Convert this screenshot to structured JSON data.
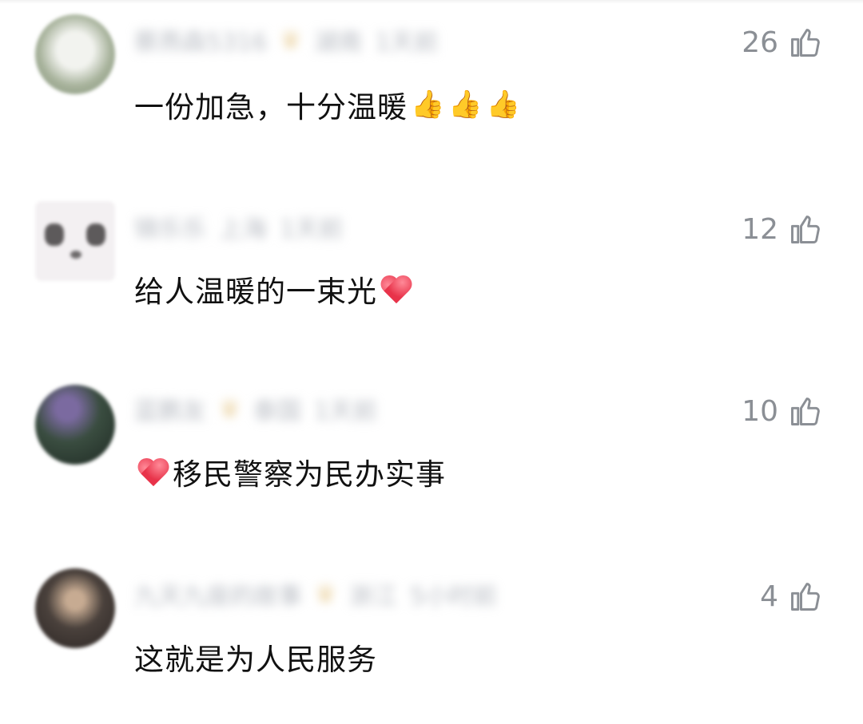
{
  "comments": [
    {
      "username": "蔡燕森5316",
      "location": "湖南",
      "time": "1天前",
      "text": "一份加急，十分温暖",
      "emojis": [
        "thumbs-up",
        "thumbs-up",
        "thumbs-up"
      ],
      "likes": "26",
      "avatar_colors": [
        "#9aa890",
        "#e8ebe4"
      ]
    },
    {
      "username": "锦乐乐",
      "location": "上海",
      "time": "1天前",
      "text": "给人温暖的一束光",
      "emoji_after": "heart",
      "likes": "12",
      "avatar_colors": [
        "#f1eef0",
        "#6b6768"
      ]
    },
    {
      "username": "蓝鹏友",
      "location": "泰国",
      "time": "1天前",
      "text": "移民警察为民办实事",
      "emoji_before": "heart",
      "likes": "10",
      "avatar_colors": [
        "#2f3d36",
        "#6c5c8c"
      ]
    },
    {
      "username": "九天九座的故事",
      "location": "浙江",
      "time": "5小时前",
      "text": "这就是为人民服务",
      "likes": "4",
      "avatar_colors": [
        "#3a3532",
        "#b59a80"
      ]
    }
  ],
  "icons": {
    "like": "thumbs-up-outline-icon",
    "heart": "heart-emoji",
    "thumb": "thumbs-up-emoji"
  }
}
